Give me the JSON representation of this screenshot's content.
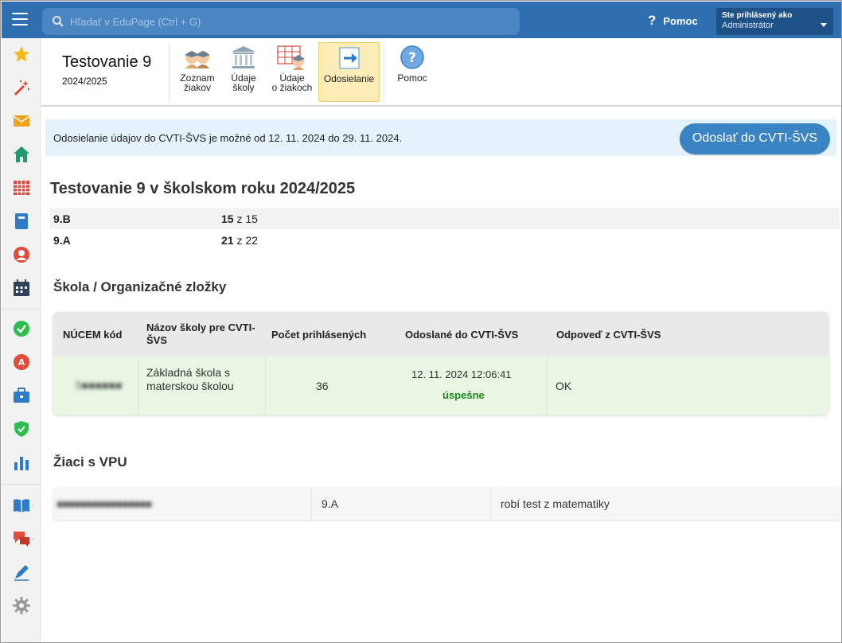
{
  "topbar": {
    "search_placeholder": "Hľadať v EduPage (Ctrl + G)",
    "help_label": "Pomoc",
    "user_line1": "Ste prihlásený ako",
    "user_line2": "Administrátor",
    "color": "#2f6fb0"
  },
  "sidebar": {
    "icons": [
      "star-icon",
      "magic-wand-icon",
      "mail-icon",
      "home-icon",
      "timetable-grid-icon",
      "notebook-icon",
      "person-icon",
      "calendar-icon",
      "check-badge-icon",
      "grade-badge-icon",
      "briefcase-icon",
      "shield-icon",
      "bar-chart-icon",
      "book-icon",
      "chat-icon",
      "pen-icon",
      "gear-icon"
    ]
  },
  "toolbar": {
    "title": "Testovanie 9",
    "year": "2024/2025",
    "buttons": [
      {
        "line1": "Zoznam",
        "line2": "žiakov",
        "icon": "students-icon"
      },
      {
        "line1": "Údaje",
        "line2": "školy",
        "icon": "school-building-icon"
      },
      {
        "line1": "Údaje",
        "line2": "o žiakoch",
        "icon": "student-data-icon"
      },
      {
        "line1": "Odosielanie",
        "line2": "",
        "icon": "send-arrow-icon"
      },
      {
        "line1": "Pomoc",
        "line2": "",
        "icon": "help-icon"
      }
    ]
  },
  "banner": {
    "text": "Odosielanie údajov do CVTI-ŠVS je možné od 12. 11. 2024 do 29. 11. 2024.",
    "button": "Odoslať do CVTI-ŠVS"
  },
  "main": {
    "heading": "Testovanie 9 v školskom roku 2024/2025",
    "classes": [
      {
        "name": "9.B",
        "count": "15",
        "sep": " z ",
        "total": "15"
      },
      {
        "name": "9.A",
        "count": "21",
        "sep": " z ",
        "total": "22"
      }
    ]
  },
  "school_section": {
    "heading": "Škola / Organizačné zložky",
    "columns": [
      "NÚCEM kód",
      "Názov školy pre CVTI-ŠVS",
      "Počet prihlásených",
      "Odoslané do CVTI-ŠVS",
      "Odpoveď z CVTI-ŠVS"
    ],
    "row": {
      "code": "5■■■■■■",
      "name_l1": "Základná škola s",
      "name_l2": "materskou školou",
      "count": "36",
      "sent_date": "12. 11. 2024 12:06:41",
      "sent_status": "úspešne",
      "response": "OK"
    }
  },
  "vpu_section": {
    "heading": "Žiaci s VPU",
    "row": {
      "student": "■■■■■■■■■■■■■■■■",
      "class": "9.A",
      "note": "robí test z matematiky"
    }
  }
}
